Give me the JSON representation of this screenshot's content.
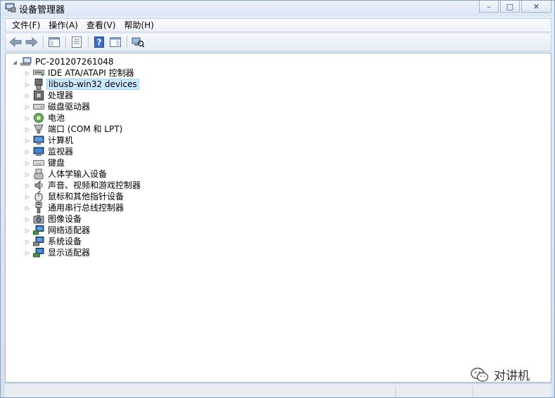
{
  "window": {
    "title": "设备管理器",
    "caption": {
      "minimize": "–",
      "maximize": "□",
      "close": "✕"
    }
  },
  "menubar": [
    {
      "label": "文件(F)",
      "icon": ""
    },
    {
      "label": "操作(A)",
      "icon": ""
    },
    {
      "label": "查看(V)",
      "icon": ""
    },
    {
      "label": "帮助(H)",
      "icon": ""
    }
  ],
  "toolbar": [
    {
      "name": "back-arrow-icon"
    },
    {
      "name": "forward-arrow-icon"
    },
    {
      "name": "show-hide-console-tree-icon"
    },
    {
      "name": "properties-icon"
    },
    {
      "name": "help-icon"
    },
    {
      "name": "show-action-pane-icon"
    },
    {
      "name": "scan-hardware-icon"
    }
  ],
  "tree": {
    "root": {
      "label": "PC-201207261048",
      "icon": "computer-icon",
      "expanded": true
    },
    "children": [
      {
        "label": "IDE ATA/ATAPI 控制器",
        "icon": "ide-controller-icon"
      },
      {
        "label": "libusb-win32 devices",
        "icon": "usb-device-icon",
        "selected": true
      },
      {
        "label": "处理器",
        "icon": "processor-icon"
      },
      {
        "label": "磁盘驱动器",
        "icon": "disk-drive-icon"
      },
      {
        "label": "电池",
        "icon": "battery-icon"
      },
      {
        "label": "端口 (COM 和 LPT)",
        "icon": "port-icon"
      },
      {
        "label": "计算机",
        "icon": "computer-icon"
      },
      {
        "label": "监视器",
        "icon": "monitor-icon"
      },
      {
        "label": "键盘",
        "icon": "keyboard-icon"
      },
      {
        "label": "人体学输入设备",
        "icon": "hid-icon"
      },
      {
        "label": "声音、视频和游戏控制器",
        "icon": "sound-icon"
      },
      {
        "label": "鼠标和其他指针设备",
        "icon": "mouse-icon"
      },
      {
        "label": "通用串行总线控制器",
        "icon": "usb-controller-icon"
      },
      {
        "label": "图像设备",
        "icon": "imaging-device-icon"
      },
      {
        "label": "网络适配器",
        "icon": "network-adapter-icon"
      },
      {
        "label": "系统设备",
        "icon": "system-device-icon"
      },
      {
        "label": "显示适配器",
        "icon": "display-adapter-icon"
      }
    ]
  },
  "watermark": {
    "text": "对讲机",
    "icon": "wechat-icon"
  }
}
